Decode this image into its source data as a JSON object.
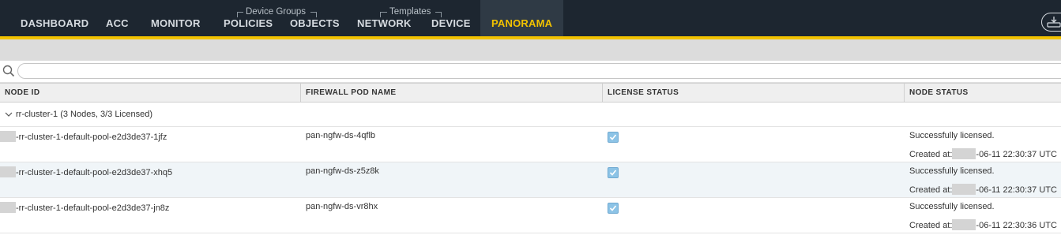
{
  "nav": {
    "items": [
      "DASHBOARD",
      "ACC",
      "MONITOR",
      "POLICIES",
      "OBJECTS",
      "NETWORK",
      "DEVICE",
      "PANORAMA"
    ],
    "active": "PANORAMA",
    "groups": {
      "device_groups": "Device Groups",
      "templates": "Templates"
    }
  },
  "colors": {
    "nav_bg": "#1d2630",
    "accent": "#f2c200",
    "check": "#8cc3e6"
  },
  "search": {
    "value": "",
    "placeholder": ""
  },
  "table": {
    "columns": [
      "NODE ID",
      "FIREWALL POD NAME",
      "LICENSE STATUS",
      "NODE STATUS"
    ],
    "group": {
      "label": "rr-cluster-1 (3 Nodes, 3/3 Licensed)"
    },
    "rows": [
      {
        "node_id": "-rr-cluster-1-default-pool-e2d3de37-1jfz",
        "pod": "pan-ngfw-ds-4qflb",
        "licensed": true,
        "status": "Successfully licensed.",
        "created_label": "Created at:",
        "created": "-06-11 22:30:37 UTC"
      },
      {
        "node_id": "-rr-cluster-1-default-pool-e2d3de37-xhq5",
        "pod": "pan-ngfw-ds-z5z8k",
        "licensed": true,
        "status": "Successfully licensed.",
        "created_label": "Created at:",
        "created": "-06-11 22:30:37 UTC"
      },
      {
        "node_id": "-rr-cluster-1-default-pool-e2d3de37-jn8z",
        "pod": "pan-ngfw-ds-vr8hx",
        "licensed": true,
        "status": "Successfully licensed.",
        "created_label": "Created at:",
        "created": "-06-11 22:30:36 UTC"
      }
    ]
  }
}
